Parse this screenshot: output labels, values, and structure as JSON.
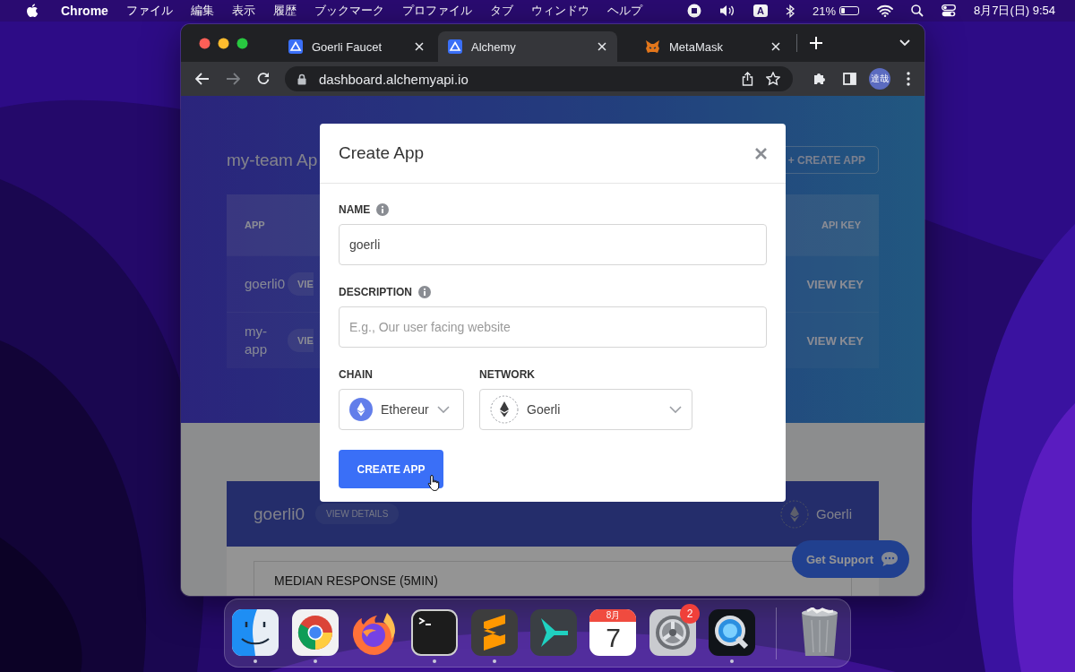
{
  "menu_bar": {
    "app": "Chrome",
    "menus": [
      "ファイル",
      "編集",
      "表示",
      "履歴",
      "ブックマーク",
      "プロファイル",
      "タブ",
      "ウィンドウ",
      "ヘルプ"
    ],
    "input_source": "A",
    "battery": {
      "reading": "21%",
      "level": 0.21
    },
    "clock": "8月7日(日) 9:54"
  },
  "browser": {
    "tabs": [
      {
        "title": "Goerli Faucet",
        "kind": "alchemy",
        "selected": false
      },
      {
        "title": "Alchemy",
        "kind": "alchemy",
        "selected": true
      },
      {
        "title": "MetaMask",
        "kind": "metamask",
        "selected": false
      }
    ],
    "url": "dashboard.alchemyapi.io",
    "profile": "達哉"
  },
  "dashboard": {
    "team_title": "my-team Ap",
    "create_button": "+ CREATE APP",
    "columns": {
      "app": "APP",
      "api_key": "API KEY"
    },
    "rows": [
      {
        "name": "goerli0",
        "details": "VIE",
        "key": "VIEW KEY"
      },
      {
        "name": "my-app",
        "details": "VIE",
        "key": "VIEW KEY"
      }
    ],
    "app_card": {
      "name": "goerli0",
      "details": "VIEW DETAILS",
      "network": "Goerli"
    },
    "panel_label": "MEDIAN RESPONSE (5MIN)",
    "support_button": "Get Support"
  },
  "dialog": {
    "title": "Create App",
    "fields": [
      {
        "label": "NAME",
        "info": true,
        "value": "goerli"
      },
      {
        "label": "DESCRIPTION",
        "info": true,
        "placeholder": "E.g., Our user facing website"
      }
    ],
    "chain": {
      "label": "CHAIN",
      "value": "Ethereur"
    },
    "network": {
      "label": "NETWORK",
      "value": "Goerli"
    },
    "submit": "CREATE APP"
  },
  "dock": {
    "apps": [
      {
        "kind": "finder",
        "running": true
      },
      {
        "kind": "chrome",
        "running": true
      },
      {
        "kind": "firefox",
        "running": false
      },
      {
        "kind": "terminal",
        "running": true
      },
      {
        "kind": "sublime",
        "running": true
      },
      {
        "kind": "arrow-app",
        "running": false
      },
      {
        "kind": "calendar",
        "running": false,
        "month": "8月",
        "day": "7"
      },
      {
        "kind": "settings",
        "running": false,
        "badge": "2"
      },
      {
        "kind": "quicktime",
        "running": true
      },
      {
        "kind": "trash",
        "running": false
      }
    ]
  }
}
